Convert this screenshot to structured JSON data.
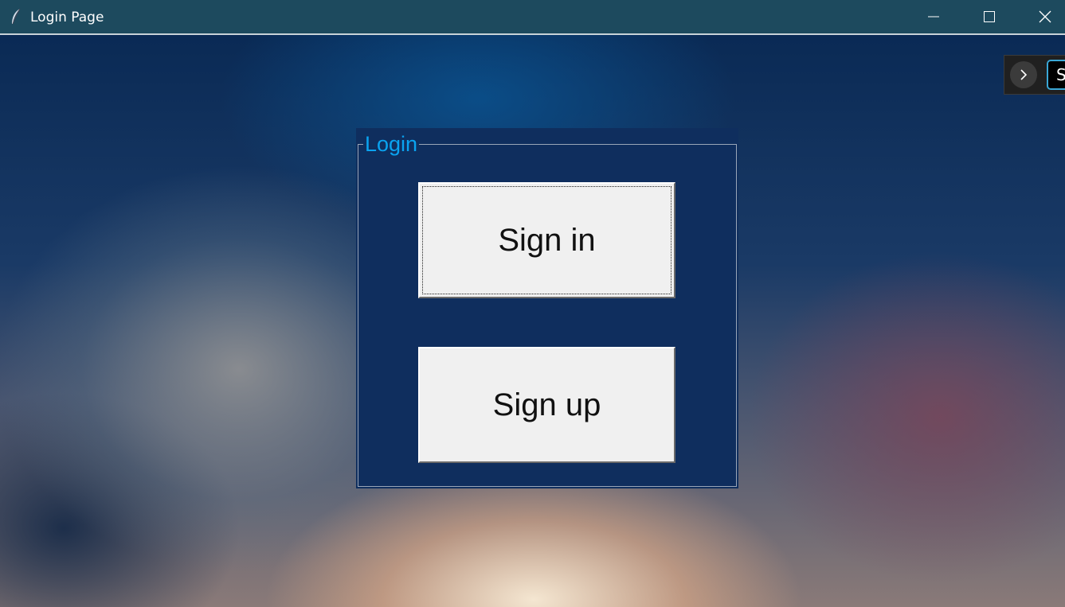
{
  "window": {
    "title": "Login Page",
    "icon": "feather-icon",
    "controls": [
      "minimize-icon",
      "maximize-icon",
      "close-icon"
    ]
  },
  "side_panel": {
    "arrow_icon": "chevron-right-icon",
    "input_value": "S"
  },
  "login": {
    "frame_label": "Login",
    "signin_label": "Sign in",
    "signup_label": "Sign up"
  },
  "colors": {
    "titlebar": "#1d4a5e",
    "frame_bg": "#0f2e5e",
    "frame_label": "#0aa3f0",
    "button_bg": "#f0f0f0",
    "input_border": "#3aa7d6"
  }
}
